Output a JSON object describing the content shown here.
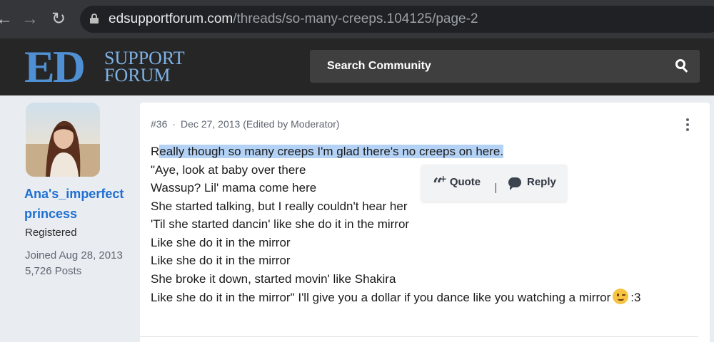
{
  "browser": {
    "url_domain": "edsupportforum.com",
    "url_path": "/threads/so-many-creeps.104125/page-2",
    "icons": [
      "back-arrow-icon",
      "forward-arrow-icon",
      "reload-icon",
      "lock-icon"
    ]
  },
  "header": {
    "logo_mark": "ED",
    "logo_line1": "SUPPORT",
    "logo_line2": "FORUM",
    "search_placeholder": "Search Community",
    "brand_color": "#4f8fd3"
  },
  "user": {
    "name": "Ana's_imperfect princess",
    "title": "Registered",
    "joined": "Joined Aug 28, 2013",
    "posts": "5,726 Posts"
  },
  "post": {
    "number": "#36",
    "separator": "·",
    "date": "Dec 27, 2013 (Edited by Moderator)",
    "first_char": "R",
    "highlighted_text": "eally though so many creeps I'm glad there's no creeps on here.",
    "lines": [
      "\"Aye, look at baby over there",
      "Wassup? Lil' mama come here",
      "She started talking, but I really couldn't hear her",
      "'Til she started dancin' like she do it in the mirror",
      "Like she do it in the mirror",
      "Like she do it in the mirror",
      "She broke it down, started movin' like Shakira"
    ],
    "last_line": "Like she do it in the mirror\" I'll give you a dollar if you dance like you watching a mirror",
    "last_line_suffix": ":3",
    "emoji": "wink-emoji"
  },
  "popup": {
    "quote_label": "Quote",
    "reply_label": "Reply",
    "divider": "|"
  }
}
